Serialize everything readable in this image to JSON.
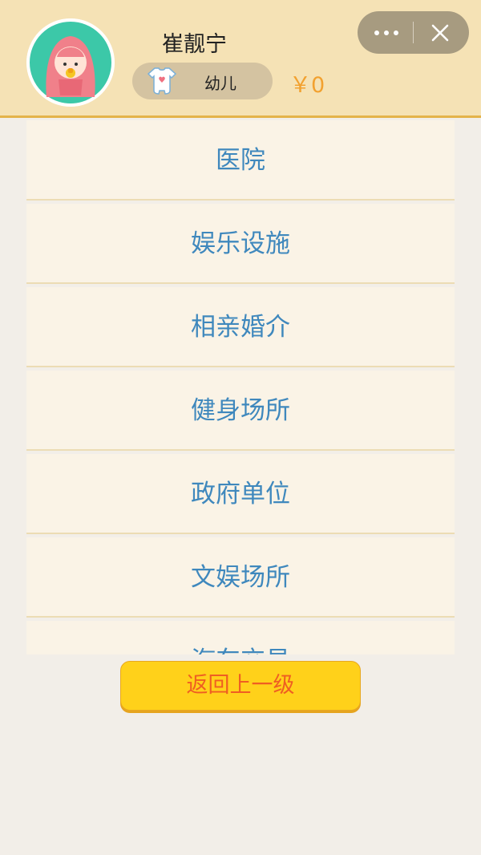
{
  "profile": {
    "name": "崔靓宁",
    "stage": "幼儿",
    "money": "￥0",
    "avatar_icon": "baby-avatar-icon",
    "stage_icon": "baby-onesie-icon"
  },
  "capsule": {
    "more_icon": "more-dots-icon",
    "close_icon": "close-icon"
  },
  "menu": {
    "items": [
      {
        "label": "医院"
      },
      {
        "label": "娱乐设施"
      },
      {
        "label": "相亲婚介"
      },
      {
        "label": "健身场所"
      },
      {
        "label": "政府单位"
      },
      {
        "label": "文娱场所"
      },
      {
        "label": "汽车交易"
      }
    ]
  },
  "back_button": {
    "label": "返回上一级"
  },
  "colors": {
    "header_bg": "#f5e2b5",
    "menu_text": "#3f88bd",
    "button_bg": "#ffd11a",
    "button_text": "#ef5e22",
    "money_text": "#f2a12f"
  }
}
